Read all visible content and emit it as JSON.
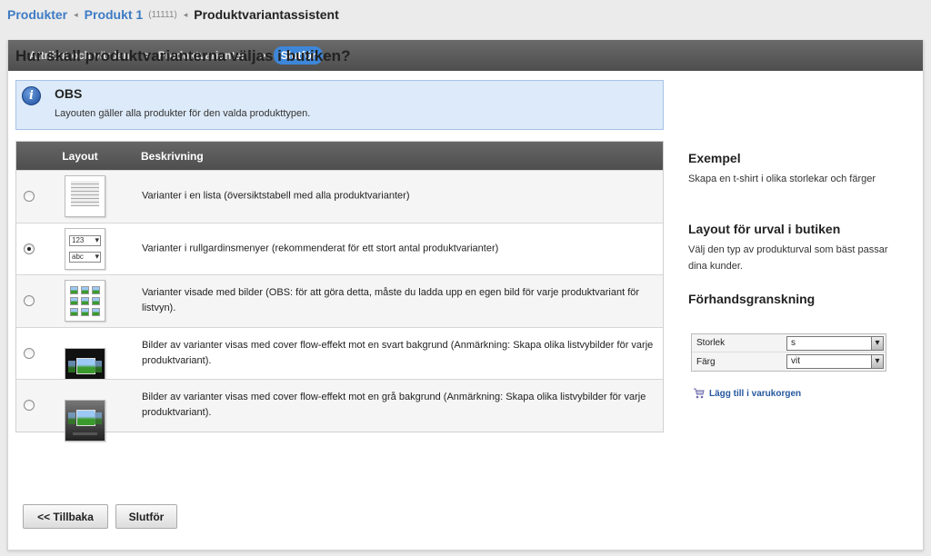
{
  "breadcrumb": {
    "products": "Produkter",
    "product": "Produkt 1",
    "product_id": "(11111)",
    "separator": "◂",
    "current": "Produktvariantassistent"
  },
  "steps": [
    {
      "label": "Attribut och värden"
    },
    {
      "label": "Produktvarianter"
    },
    {
      "label": "Slutför"
    }
  ],
  "step_arrow": ">",
  "heading": "Hur skall produktvarianterna väljas i butiken?",
  "info": {
    "icon": "info-icon",
    "glyph": "i",
    "title": "OBS",
    "text": "Layouten gäller alla produkter för den valda produkttypen."
  },
  "table": {
    "headers": {
      "layout": "Layout",
      "description": "Beskrivning"
    },
    "rows": [
      {
        "desc": "Varianter i en lista (översiktstabell med alla produktvarianter)",
        "selected": false
      },
      {
        "desc": "Varianter i rullgardinsmenyer (rekommenderat för ett stort antal produktvarianter)",
        "selected": true
      },
      {
        "desc": "Varianter visade med bilder (OBS: för att göra detta, måste du ladda upp en egen bild för varje produkt­variant för listvyn).",
        "selected": false
      },
      {
        "desc": "Bilder av varianter visas med cover flow-effekt mot en svart bakgrund (Anmärkning: Skapa olika listvy­bilder för varje produktvariant).",
        "selected": false
      },
      {
        "desc": "Bilder av varianter visas med cover flow-effekt mot en grå bakgrund (Anmärkning: Skapa olika listvy­bilder för varje produktvariant).",
        "selected": false
      }
    ],
    "thumb_dropdown_values": [
      "123",
      "abc"
    ]
  },
  "buttons": {
    "back": "<< Tillbaka",
    "finish": "Slutför"
  },
  "sidebar": {
    "example_title": "Exempel",
    "example_text": "Skapa en t-shirt i olika storlekar och färger",
    "layout_title": "Layout för urval i butiken",
    "layout_text": "Välj den typ av produkturval som bäst passar dina kunder.",
    "preview_title": "Förhandsgranskning",
    "preview": [
      {
        "label": "Storlek",
        "value": "s"
      },
      {
        "label": "Färg",
        "value": "vit"
      }
    ],
    "cart_link": "Lägg till i varukorgen",
    "cart_icon": "cart-icon"
  },
  "colors": {
    "link": "#3e7bc4",
    "active_step": "#3d86d8",
    "info_bg": "#ddeaf9"
  }
}
